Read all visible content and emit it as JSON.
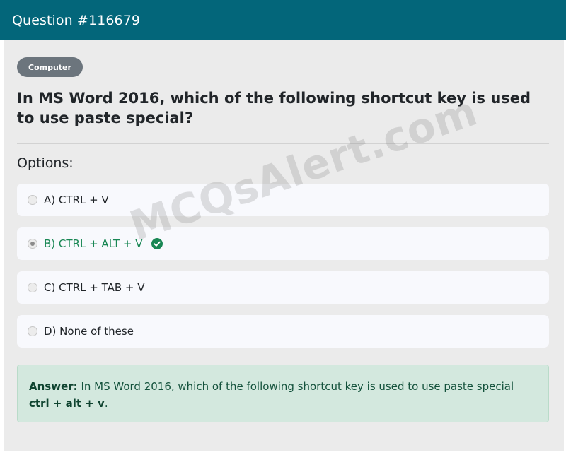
{
  "header": {
    "title": "Question #116679"
  },
  "question": {
    "category": "Computer",
    "text": "In MS Word 2016, which of the following shortcut key is used to use paste special?"
  },
  "options_label": "Options:",
  "options": [
    {
      "label": "A) CTRL + V",
      "selected": false,
      "correct": false
    },
    {
      "label": "B) CTRL + ALT + V",
      "selected": true,
      "correct": true
    },
    {
      "label": "C) CTRL + TAB + V",
      "selected": false,
      "correct": false
    },
    {
      "label": "D) None of these",
      "selected": false,
      "correct": false
    }
  ],
  "watermark": "MCQsAlert.com",
  "answer": {
    "prefix": "Answer:",
    "text": "In MS Word 2016, which of the following shortcut key is used to use paste special",
    "key": "ctrl + alt + v",
    "suffix": "."
  },
  "colors": {
    "header_bg": "#03667a",
    "correct_green": "#198754",
    "answer_bg": "#d3e8de",
    "badge_bg": "#6c757d"
  },
  "icons": {
    "correct_marker": "check-circle-icon"
  }
}
